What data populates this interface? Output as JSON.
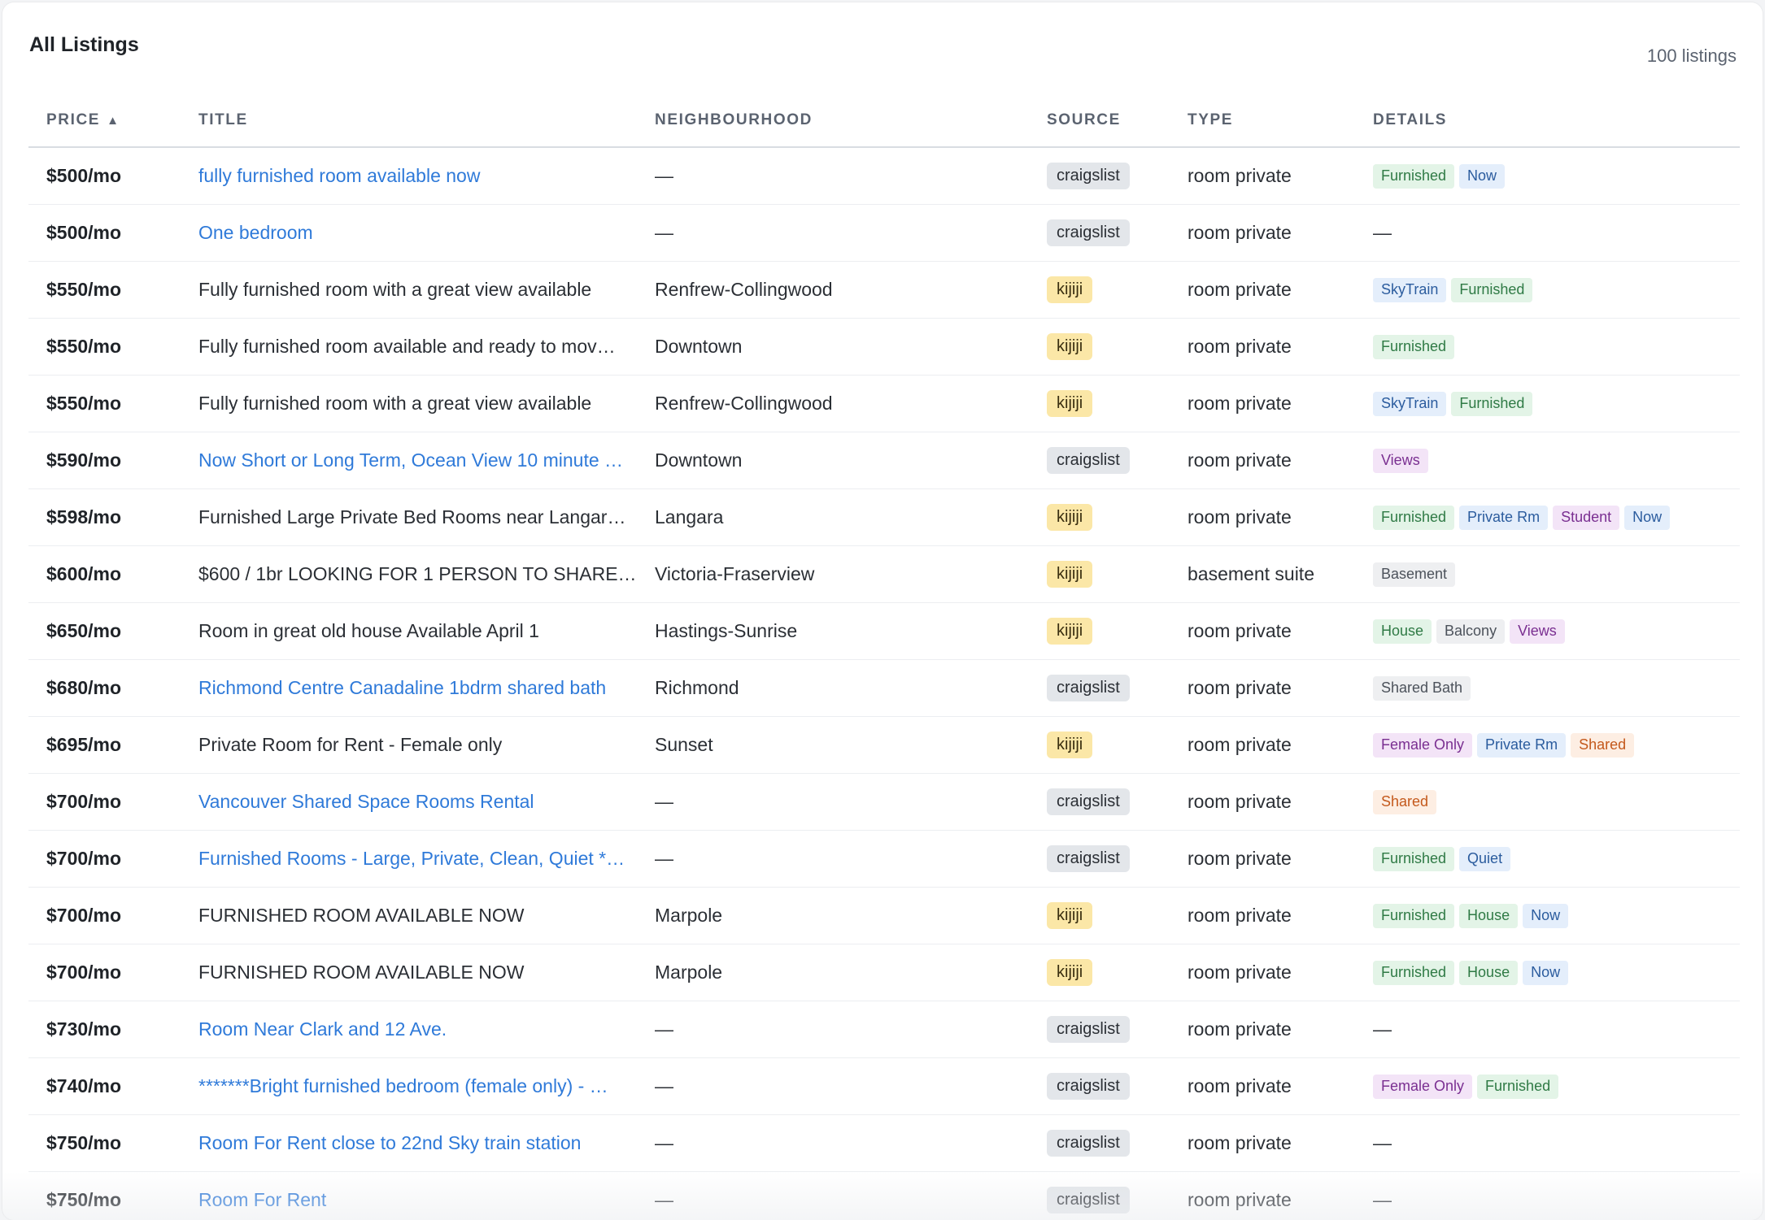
{
  "header": {
    "title": "All Listings",
    "count": "100 listings"
  },
  "columns": {
    "price": "PRICE",
    "title": "TITLE",
    "neighbourhood": "NEIGHBOURHOOD",
    "source": "SOURCE",
    "type": "TYPE",
    "details": "DETAILS",
    "sort_arrow": "▲"
  },
  "tag_colors": {
    "Furnished": "green",
    "House": "green",
    "Balcony": "gray",
    "Now": "blue",
    "SkyTrain": "blue",
    "Private Rm": "blue",
    "Quiet": "blue",
    "Views": "purple",
    "Student": "purple",
    "Female Only": "purple",
    "Basement": "gray",
    "Shared Bath": "gray",
    "Shared": "orange"
  },
  "source_colors": {
    "craigslist": "#e3e6ea",
    "kijiji": "#fbe7a7"
  },
  "link_color": "#2f7ad9",
  "rows": [
    {
      "price": "$500/mo",
      "title": "fully furnished room available now",
      "link": true,
      "neighbourhood": "—",
      "source": "craigslist",
      "type": "room private",
      "details": [
        "Furnished",
        "Now"
      ]
    },
    {
      "price": "$500/mo",
      "title": "One bedroom",
      "link": true,
      "neighbourhood": "—",
      "source": "craigslist",
      "type": "room private",
      "details": []
    },
    {
      "price": "$550/mo",
      "title": "Fully furnished room with a great view available",
      "link": false,
      "neighbourhood": "Renfrew-Collingwood",
      "source": "kijiji",
      "type": "room private",
      "details": [
        "SkyTrain",
        "Furnished"
      ]
    },
    {
      "price": "$550/mo",
      "title": "Fully furnished room available and ready to mov…",
      "link": false,
      "neighbourhood": "Downtown",
      "source": "kijiji",
      "type": "room private",
      "details": [
        "Furnished"
      ]
    },
    {
      "price": "$550/mo",
      "title": "Fully furnished room with a great view available",
      "link": false,
      "neighbourhood": "Renfrew-Collingwood",
      "source": "kijiji",
      "type": "room private",
      "details": [
        "SkyTrain",
        "Furnished"
      ]
    },
    {
      "price": "$590/mo",
      "title": "Now Short or Long Term, Ocean View 10 minute …",
      "link": true,
      "neighbourhood": "Downtown",
      "source": "craigslist",
      "type": "room private",
      "details": [
        "Views"
      ]
    },
    {
      "price": "$598/mo",
      "title": "Furnished Large Private Bed Rooms near Langar…",
      "link": false,
      "neighbourhood": "Langara",
      "source": "kijiji",
      "type": "room private",
      "details": [
        "Furnished",
        "Private Rm",
        "Student",
        "Now"
      ]
    },
    {
      "price": "$600/mo",
      "title": "$600 / 1br LOOKING FOR 1 PERSON TO SHARE …",
      "link": false,
      "neighbourhood": "Victoria-Fraserview",
      "source": "kijiji",
      "type": "basement suite",
      "details": [
        "Basement"
      ]
    },
    {
      "price": "$650/mo",
      "title": "Room in great old house Available April 1",
      "link": false,
      "neighbourhood": "Hastings-Sunrise",
      "source": "kijiji",
      "type": "room private",
      "details": [
        "House",
        "Balcony",
        "Views"
      ]
    },
    {
      "price": "$680/mo",
      "title": "Richmond Centre Canadaline 1bdrm shared bath",
      "link": true,
      "neighbourhood": "Richmond",
      "source": "craigslist",
      "type": "room private",
      "details": [
        "Shared Bath"
      ]
    },
    {
      "price": "$695/mo",
      "title": "Private Room for Rent - Female only",
      "link": false,
      "neighbourhood": "Sunset",
      "source": "kijiji",
      "type": "room private",
      "details": [
        "Female Only",
        "Private Rm",
        "Shared"
      ]
    },
    {
      "price": "$700/mo",
      "title": "Vancouver Shared Space Rooms Rental",
      "link": true,
      "neighbourhood": "—",
      "source": "craigslist",
      "type": "room private",
      "details": [
        "Shared"
      ]
    },
    {
      "price": "$700/mo",
      "title": "Furnished Rooms - Large, Private, Clean, Quiet *…",
      "link": true,
      "neighbourhood": "—",
      "source": "craigslist",
      "type": "room private",
      "details": [
        "Furnished",
        "Quiet"
      ]
    },
    {
      "price": "$700/mo",
      "title": "FURNISHED ROOM AVAILABLE NOW",
      "link": false,
      "neighbourhood": "Marpole",
      "source": "kijiji",
      "type": "room private",
      "details": [
        "Furnished",
        "House",
        "Now"
      ]
    },
    {
      "price": "$700/mo",
      "title": "FURNISHED ROOM AVAILABLE NOW",
      "link": false,
      "neighbourhood": "Marpole",
      "source": "kijiji",
      "type": "room private",
      "details": [
        "Furnished",
        "House",
        "Now"
      ]
    },
    {
      "price": "$730/mo",
      "title": "Room Near Clark and 12 Ave.",
      "link": true,
      "neighbourhood": "—",
      "source": "craigslist",
      "type": "room private",
      "details": []
    },
    {
      "price": "$740/mo",
      "title": "*******Bright furnished bedroom (female only) - …",
      "link": true,
      "neighbourhood": "—",
      "source": "craigslist",
      "type": "room private",
      "details": [
        "Female Only",
        "Furnished"
      ]
    },
    {
      "price": "$750/mo",
      "title": "Room For Rent close to 22nd Sky train station",
      "link": true,
      "neighbourhood": "—",
      "source": "craigslist",
      "type": "room private",
      "details": []
    },
    {
      "price": "$750/mo",
      "title": "Room For Rent",
      "link": true,
      "neighbourhood": "—",
      "source": "craigslist",
      "type": "room private",
      "details": []
    }
  ],
  "empty_details": "—"
}
